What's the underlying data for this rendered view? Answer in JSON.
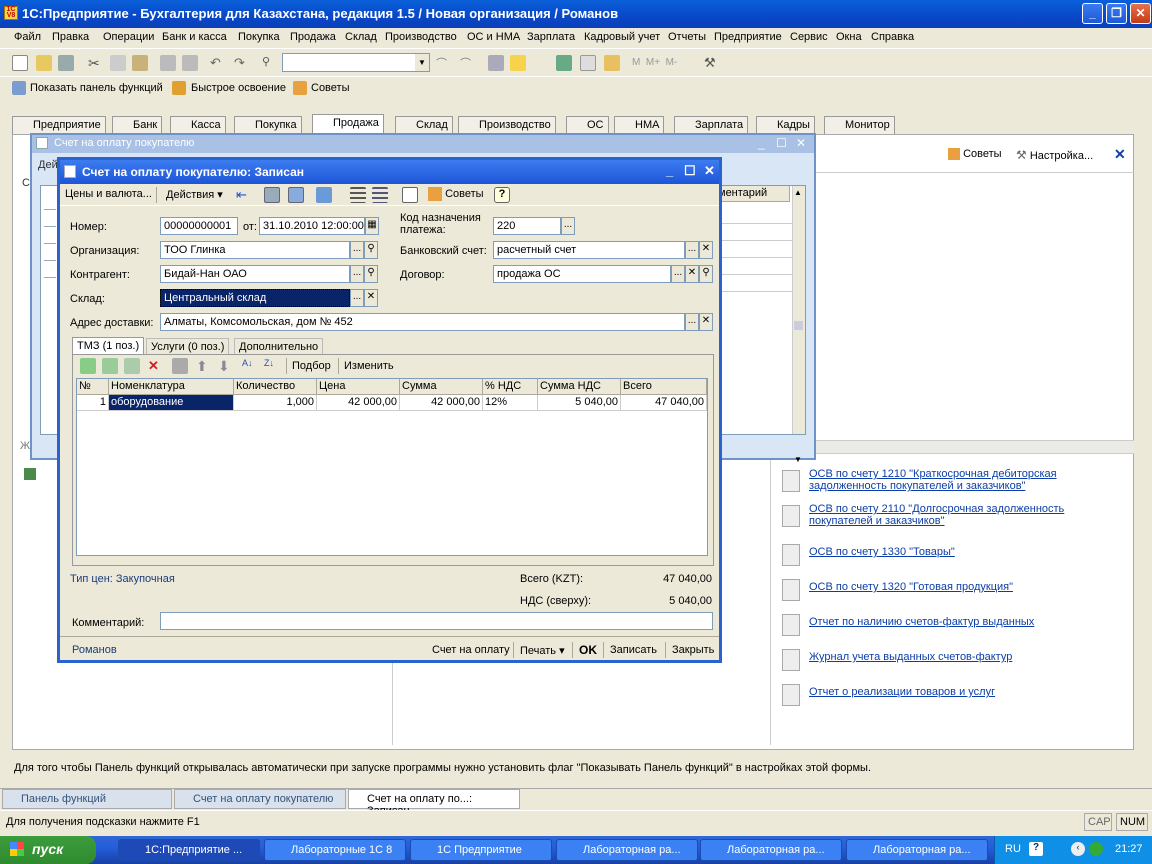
{
  "app": {
    "title": "1С:Предприятие - Бухгалтерия для Казахстана, редакция 1.5 / Новая организация / Романов"
  },
  "menu": [
    "Файл",
    "Правка",
    "Операции",
    "Банк и касса",
    "Покупка",
    "Продажа",
    "Склад",
    "Производство",
    "ОС и НМА",
    "Зарплата",
    "Кадровый учет",
    "Отчеты",
    "Предприятие",
    "Сервис",
    "Окна",
    "Справка"
  ],
  "toolbar2": {
    "show_panel": "Показать панель функций",
    "quick_learn": "Быстрое освоение",
    "tips": "Советы"
  },
  "section_tabs": [
    "Предприятие",
    "Банк",
    "Касса",
    "Покупка",
    "Продажа",
    "Склад",
    "Производство",
    "ОС",
    "НМА",
    "Зарплата",
    "Кадры",
    "Монитор"
  ],
  "right_panel": {
    "tips": "Советы",
    "settings": "Настройка...",
    "links": [
      "ОСВ по счету 1210 \"Краткосрочная дебиторская задолженность покупателей и заказчиков\"",
      "ОСВ по счету 2110 \"Долгосрочная задолженность покупателей и заказчиков\"",
      "ОСВ по счету 1330 \"Товары\"",
      "ОСВ по счету 1320 \"Готовая продукция\"",
      "Отчет по наличию счетов-фактур выданных",
      "Журнал учета выданных счетов-фактур",
      "Отчет о реализации товаров и услуг"
    ]
  },
  "list_window": {
    "title": "Счет на оплату покупателю",
    "col_partial": "ментарий",
    "menu_partial": "Дей",
    "col_c": "С"
  },
  "doc": {
    "title": "Счет на оплату покупателю: Записан",
    "menu": {
      "prices": "Цены и валюта...",
      "actions": "Действия",
      "tips": "Советы"
    },
    "number_label": "Номер:",
    "number": "00000000001",
    "date_label": "от:",
    "date": "31.10.2010 12:00:00",
    "org_label": "Организация:",
    "org": "ТОО Глинка",
    "counterparty_label": "Контрагент:",
    "counterparty": "Бидай-Нан ОАО",
    "warehouse_label": "Склад:",
    "warehouse": "Центральный склад",
    "address_label": "Адрес доставки:",
    "address": "Алматы, Комсомольская, дом № 452",
    "payment_code_label": "Код назначения платежа:",
    "payment_code": "220",
    "bank_label": "Банковский счет:",
    "bank": "расчетный  счет",
    "contract_label": "Договор:",
    "contract": "продажа ОС",
    "tabs": [
      "ТМЗ (1 поз.)",
      "Услуги (0 поз.)",
      "Дополнительно"
    ],
    "grid_toolbar": {
      "pick": "Подбор",
      "change": "Изменить"
    },
    "columns": [
      "№",
      "Номенклатура",
      "Количество",
      "Цена",
      "Сумма",
      "% НДС",
      "Сумма НДС",
      "Всего"
    ],
    "rows": [
      [
        "1",
        "оборудование",
        "1,000",
        "42 000,00",
        "42 000,00",
        "12%",
        "5 040,00",
        "47 040,00"
      ]
    ],
    "price_type": "Тип цен: Закупочная",
    "total_label": "Всего (KZT):",
    "total": "47 040,00",
    "vat_label": "НДС (сверху):",
    "vat": "5 040,00",
    "comment_label": "Комментарий:",
    "comment": "",
    "user": "Романов",
    "buttons": {
      "invoice": "Счет на оплату",
      "print": "Печать",
      "ok": "OK",
      "save": "Записать",
      "close": "Закрыть"
    }
  },
  "hint_line": "Для того чтобы Панель функций открывалась автоматически при запуске программы нужно установить флаг \"Показывать Панель функций\" в настройках этой формы.",
  "window_tabs": [
    "Панель функций",
    "Счет на оплату покупателю",
    "Счет на оплату по...: Записан"
  ],
  "status": {
    "help": "Для получения подсказки нажмите F1",
    "cap": "CAP",
    "num": "NUM"
  },
  "taskbar": {
    "start": "пуск",
    "items": [
      "1С:Предприятие ...",
      "Лабораторные 1С 8",
      "1С Предприятие",
      "Лабораторная ра...",
      "Лабораторная ра...",
      "Лабораторная ра..."
    ],
    "lang": "RU",
    "time": "21:27"
  }
}
